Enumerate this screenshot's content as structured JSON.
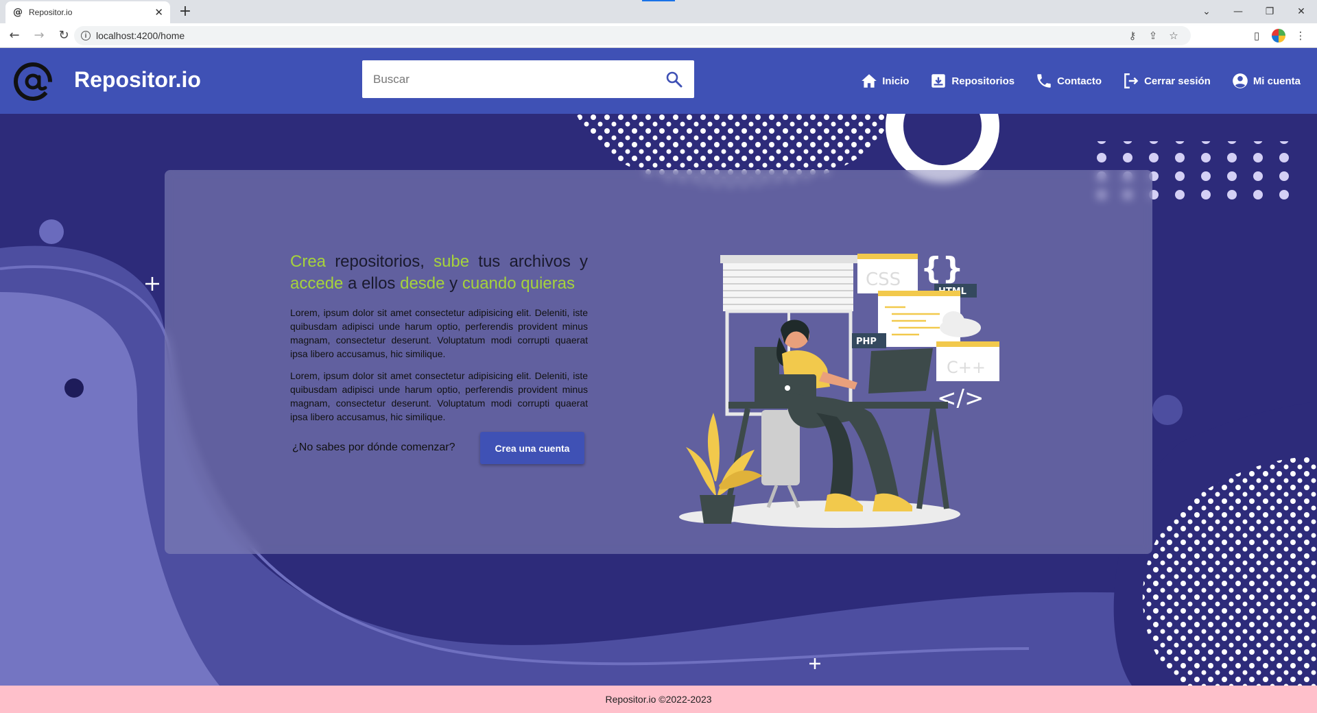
{
  "browser": {
    "tab_title": "Repositor.io",
    "tab_favicon": "@",
    "url": "localhost:4200/home"
  },
  "header": {
    "brand": "Repositor.io",
    "search_placeholder": "Buscar",
    "nav": {
      "home": "Inicio",
      "repos": "Repositorios",
      "contact": "Contacto",
      "logout": "Cerrar sesión",
      "account": "Mi cuenta"
    }
  },
  "hero": {
    "headline": {
      "w1": "Crea",
      "w2": " repositorios, ",
      "w3": "sube",
      "w4": " tus archivos y ",
      "w5": "accede",
      "w6": " a ellos ",
      "w7": "desde",
      "w8": " y ",
      "w9": "cuando quieras"
    },
    "paragraph_1": "Lorem, ipsum dolor sit amet consectetur adipisicing elit. Deleniti, iste quibusdam adipisci unde harum optio, perferendis provident minus magnam, consectetur deserunt. Voluptatum modi corrupti quaerat ipsa libero accusamus, hic similique.",
    "paragraph_2": "Lorem, ipsum dolor sit amet consectetur adipisicing elit. Deleniti, iste quibusdam adipisci unde harum optio, perferendis provident minus magnam, consectetur deserunt. Voluptatum modi corrupti quaerat ipsa libero accusamus, hic similique.",
    "cta_question": "¿No sabes por dónde comenzar?",
    "cta_button": "Crea una cuenta",
    "illustration_labels": {
      "css": "CSS",
      "html": "HTML",
      "php": "PHP",
      "cpp": "C++",
      "braces": "{}",
      "code": "</>"
    }
  },
  "footer": {
    "text": "Repositor.io ©2022-2023"
  },
  "colors": {
    "primary": "#3f51b5",
    "accent": "#a6d33b",
    "hero_bg": "#2d2b7a",
    "footer_bg": "#ffc0cb"
  }
}
